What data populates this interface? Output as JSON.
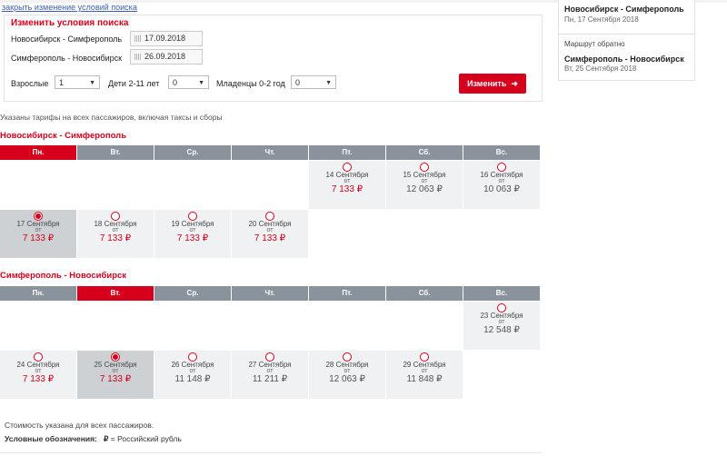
{
  "top_link": "закрыть изменение условий поиска",
  "search": {
    "title": "Изменить условия поиска",
    "route1": "Новосибирск - Симферополь",
    "date1": "17.09.2018",
    "route2": "Симферополь - Новосибирск",
    "date2": "26.09.2018",
    "adults_label": "Взрослые",
    "adults_value": "1",
    "children_label": "Дети 2-11 лет",
    "children_value": "0",
    "infants_label": "Младенцы 0-2 год",
    "infants_value": "0",
    "button": "Изменить"
  },
  "side": {
    "out_route": "Новосибирск - Симферополь",
    "out_date": "Пн, 17 Сентября 2018",
    "return_label": "Маршрут обратно",
    "ret_route": "Симферополь - Новосибирск",
    "ret_date": "Вт, 25 Сентября 2018"
  },
  "note": "Указаны тарифы на всех пассажиров, включая таксы и сборы",
  "days": [
    "Пн.",
    "Вт.",
    "Ср.",
    "Чт.",
    "Пт.",
    "Сб.",
    "Вс."
  ],
  "sections": [
    {
      "title": "Новосибирск - Симферополь",
      "active_day": 0,
      "rows": [
        [
          null,
          null,
          null,
          null,
          {
            "date": "14 Сентября",
            "from": "от",
            "price": "7 133 ₽",
            "color": "red",
            "selected": false
          },
          {
            "date": "15 Сентября",
            "from": "от",
            "price": "12 063 ₽",
            "color": "gray",
            "selected": false
          },
          {
            "date": "16 Сентября",
            "from": "от",
            "price": "10 063 ₽",
            "color": "gray",
            "selected": false
          }
        ],
        [
          {
            "date": "17 Сентября",
            "from": "от",
            "price": "7 133 ₽",
            "color": "red",
            "selected": true
          },
          {
            "date": "18 Сентября",
            "from": "от",
            "price": "7 133 ₽",
            "color": "red",
            "selected": false
          },
          {
            "date": "19 Сентября",
            "from": "от",
            "price": "7 133 ₽",
            "color": "red",
            "selected": false
          },
          {
            "date": "20 Сентября",
            "from": "от",
            "price": "7 133 ₽",
            "color": "red",
            "selected": false
          },
          null,
          null,
          null
        ]
      ]
    },
    {
      "title": "Симферополь - Новосибирск",
      "active_day": 1,
      "rows": [
        [
          null,
          null,
          null,
          null,
          null,
          null,
          {
            "date": "23 Сентября",
            "from": "от",
            "price": "12 548 ₽",
            "color": "gray",
            "selected": false
          }
        ],
        [
          {
            "date": "24 Сентября",
            "from": "от",
            "price": "7 133 ₽",
            "color": "red",
            "selected": false
          },
          {
            "date": "25 Сентября",
            "from": "от",
            "price": "7 133 ₽",
            "color": "red",
            "selected": true
          },
          {
            "date": "26 Сентября",
            "from": "от",
            "price": "11 148 ₽",
            "color": "gray",
            "selected": false
          },
          {
            "date": "27 Сентября",
            "from": "от",
            "price": "11 211 ₽",
            "color": "gray",
            "selected": false
          },
          {
            "date": "28 Сентября",
            "from": "от",
            "price": "12 063 ₽",
            "color": "gray",
            "selected": false
          },
          {
            "date": "29 Сентября",
            "from": "от",
            "price": "11 848 ₽",
            "color": "gray",
            "selected": false
          },
          null
        ]
      ]
    }
  ],
  "footer": {
    "cost_note": "Стоимость указана для всех пассажиров.",
    "legend_label": "Условные обозначения:",
    "legend_symbol": "₽",
    "legend_text": "= Российский рубль"
  }
}
